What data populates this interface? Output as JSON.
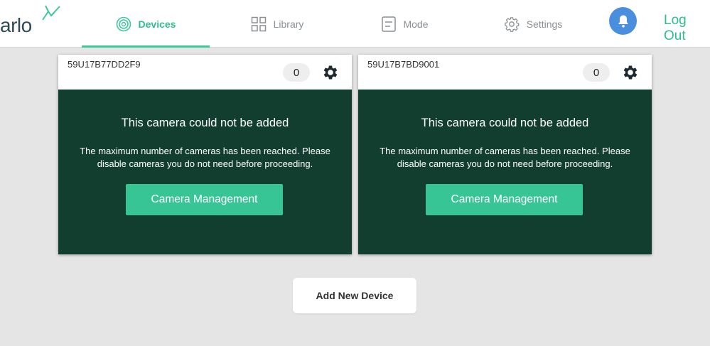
{
  "brand": {
    "name": "arlo",
    "color": "#2e4b59",
    "accent": "#2fbf8c"
  },
  "nav": {
    "tabs": [
      {
        "label": "Devices",
        "icon": "devices-icon",
        "active": true
      },
      {
        "label": "Library",
        "icon": "library-grid-icon",
        "active": false
      },
      {
        "label": "Mode",
        "icon": "mode-icon",
        "active": false
      },
      {
        "label": "Settings",
        "icon": "gear-icon",
        "active": false
      }
    ],
    "notifications_icon": "bell-icon",
    "logout_label": "Log Out"
  },
  "devices": [
    {
      "id": "59U17B77DD2F9",
      "count": "0",
      "settings_icon": "gear-icon",
      "title": "This camera could not be added",
      "message": "The maximum number of cameras has been reached. Please disable cameras you do not need before proceeding.",
      "button_label": "Camera Management"
    },
    {
      "id": "59U17B7BD9001",
      "count": "0",
      "settings_icon": "gear-icon",
      "title": "This camera could not be added",
      "message": "The maximum number of cameras has been reached. Please disable cameras you do not need before proceeding.",
      "button_label": "Camera Management"
    }
  ],
  "add_device_label": "Add New Device",
  "colors": {
    "card_bg": "#113e2e",
    "button_bg": "#37c595",
    "page_bg": "#e5e5e5",
    "bell_bg": "#4a8fde"
  }
}
